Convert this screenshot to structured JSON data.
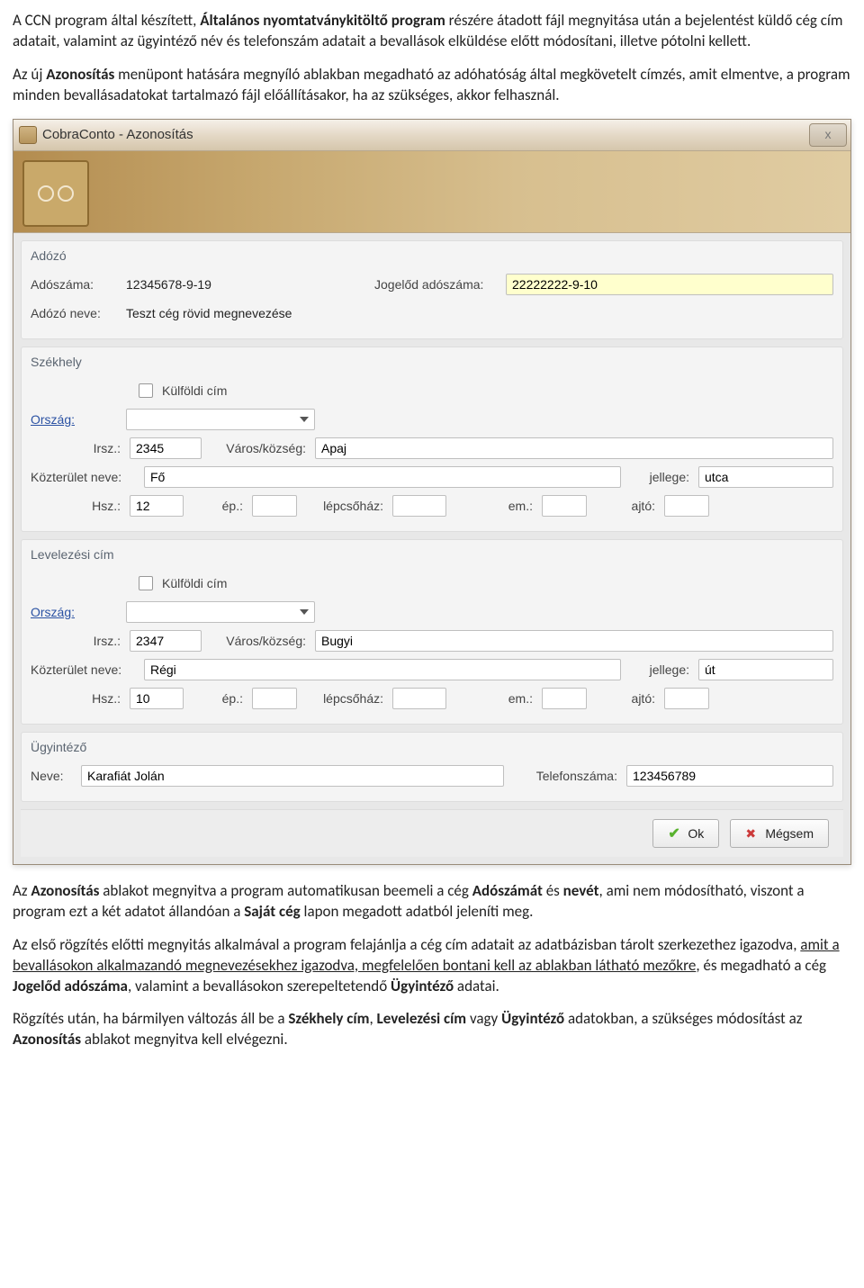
{
  "doc": {
    "p1": "A CCN program által készített, Általános nyomtatványkitöltő program részére átadott fájl megnyitása után a bejelentést küldő cég cím adatait, valamint az ügyintéző név és telefonszám adatait a bevallások elküldése előtt módosítani, illetve pótolni kellett.",
    "p1_bold": "Általános nyomtatványkitöltő program",
    "p2_prefix": "Az új ",
    "p2_bold": "Azonosítás",
    "p2_rest": " menüpont hatására megnyíló ablakban megadható az adóhatóság által megkövetelt címzés, amit elmentve, a program minden bevallásadatokat tartalmazó fájl előállításakor, ha az szükséges, akkor felhasznál.",
    "pA_prefix": "Az ",
    "pA_bold1": "Azonosítás",
    "pA_mid1": " ablakot megnyitva a program automatikusan beemeli a cég ",
    "pA_bold2": "Adószámát",
    "pA_mid2": " és ",
    "pA_bold3": "nevét",
    "pA_mid3": ", ami nem módosítható, viszont a program ezt a két adatot állandóan a ",
    "pA_bold4": "Saját cég",
    "pA_rest": " lapon megadott adatból jeleníti meg.",
    "pB_prefix": "Az első rögzítés előtti megnyitás alkalmával a program felajánlja a cég cím adatait az adatbázisban tárolt szerkezethez igazodva, ",
    "pB_underline": "amit a bevallásokon alkalmazandó megnevezésekhez igazodva, megfelelően bontani kell az ablakban látható mezőkre",
    "pB_mid": ", és megadható a cég ",
    "pB_bold1": "Jogelőd adószáma",
    "pB_mid2": ", valamint a bevallásokon szerepeltetendő ",
    "pB_bold2": "Ügyintéző",
    "pB_rest": " adatai.",
    "pC_prefix": "Rögzítés után, ha bármilyen változás áll be a ",
    "pC_bold1": "Székhely cím",
    "pC_mid1": ", ",
    "pC_bold2": "Levelezési cím",
    "pC_mid2": " vagy ",
    "pC_bold3": "Ügyintéző",
    "pC_mid3": " adatokban, a szükséges módosítást az ",
    "pC_bold4": "Azonosítás",
    "pC_rest": " ablakot megnyitva kell elvégezni."
  },
  "window": {
    "title": "CobraConto - Azonosítás",
    "close_aria": "Bezárás",
    "groups": {
      "adozo": {
        "title": "Adózó",
        "adoszam_label": "Adószáma:",
        "adoszam_value": "12345678-9-19",
        "jogelod_label": "Jogelőd adószáma:",
        "jogelod_value": "22222222-9-10",
        "nev_label": "Adózó neve:",
        "nev_value": "Teszt cég rövid megnevezése"
      },
      "szekhely": {
        "title": "Székhely",
        "kulfoldi_label": "Külföldi cím",
        "orszag_label": "Ország:",
        "orszag_value": "",
        "irsz_label": "Irsz.:",
        "irsz_value": "2345",
        "varos_label": "Város/község:",
        "varos_value": "Apaj",
        "kozterulet_label": "Közterület neve:",
        "kozterulet_value": "Fő",
        "jellege_label": "jellege:",
        "jellege_value": "utca",
        "hsz_label": "Hsz.:",
        "hsz_value": "12",
        "ep_label": "ép.:",
        "ep_value": "",
        "lepcsohaz_label": "lépcsőház:",
        "lepcsohaz_value": "",
        "em_label": "em.:",
        "em_value": "",
        "ajto_label": "ajtó:",
        "ajto_value": ""
      },
      "levelezes": {
        "title": "Levelezési cím",
        "kulfoldi_label": "Külföldi cím",
        "orszag_label": "Ország:",
        "orszag_value": "",
        "irsz_label": "Irsz.:",
        "irsz_value": "2347",
        "varos_label": "Város/község:",
        "varos_value": "Bugyi",
        "kozterulet_label": "Közterület neve:",
        "kozterulet_value": "Régi",
        "jellege_label": "jellege:",
        "jellege_value": "út",
        "hsz_label": "Hsz.:",
        "hsz_value": "10",
        "ep_label": "ép.:",
        "ep_value": "",
        "lepcsohaz_label": "lépcsőház:",
        "lepcsohaz_value": "",
        "em_label": "em.:",
        "em_value": "",
        "ajto_label": "ajtó:",
        "ajto_value": ""
      },
      "ugyintezo": {
        "title": "Ügyintéző",
        "nev_label": "Neve:",
        "nev_value": "Karafiát Jolán",
        "tel_label": "Telefonszáma:",
        "tel_value": "123456789"
      }
    },
    "buttons": {
      "ok": "Ok",
      "cancel": "Mégsem"
    }
  }
}
